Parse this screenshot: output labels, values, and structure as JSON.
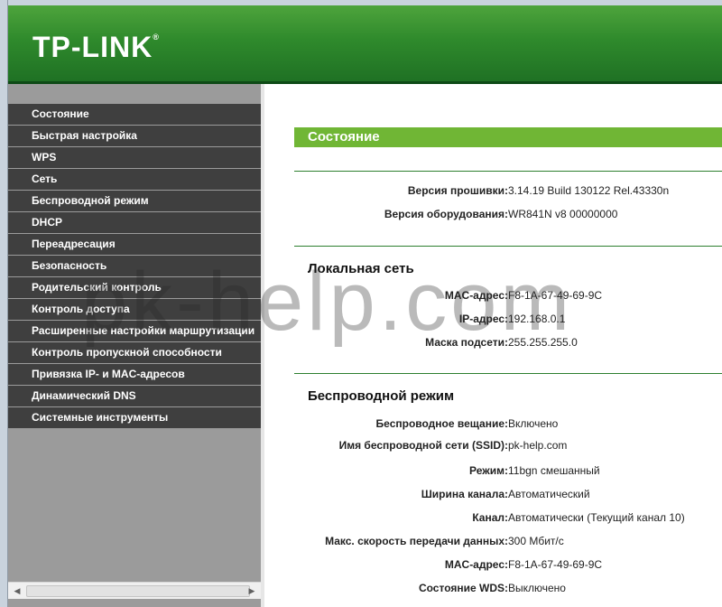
{
  "brand": {
    "logo_text": "TP-LINK",
    "logo_mark": "®"
  },
  "sidebar": {
    "items": [
      {
        "label": "Состояние"
      },
      {
        "label": "Быстрая настройка"
      },
      {
        "label": "WPS"
      },
      {
        "label": "Сеть"
      },
      {
        "label": "Беспроводной режим"
      },
      {
        "label": "DHCP"
      },
      {
        "label": "Переадресация"
      },
      {
        "label": "Безопасность"
      },
      {
        "label": "Родительский контроль"
      },
      {
        "label": "Контроль доступа"
      },
      {
        "label": "Расширенные настройки маршрутизации"
      },
      {
        "label": "Контроль пропускной способности"
      },
      {
        "label": "Привязка IP- и MAC-адресов"
      },
      {
        "label": "Динамический DNS"
      },
      {
        "label": "Системные инструменты"
      }
    ]
  },
  "main": {
    "title": "Состояние",
    "firmware": {
      "version_label": "Версия прошивки:",
      "version_value": "3.14.19 Build 130122 Rel.43330n",
      "hw_label": "Версия оборудования:",
      "hw_value": "WR841N v8 00000000"
    },
    "lan": {
      "title": "Локальная сеть",
      "mac_label": "MAC-адрес:",
      "mac_value": "F8-1A-67-49-69-9C",
      "ip_label": "IP-адрес:",
      "ip_value": "192.168.0.1",
      "mask_label": "Маска подсети:",
      "mask_value": "255.255.255.0"
    },
    "wireless": {
      "title": "Беспроводной режим",
      "broadcast_label": "Беспроводное вещание:",
      "broadcast_value": "Включено",
      "ssid_label": "Имя беспроводной сети (SSID):",
      "ssid_value": "pk-help.com",
      "mode_label": "Режим:",
      "mode_value": "11bgn смешанный",
      "width_label": "Ширина канала:",
      "width_value": "Автоматический",
      "channel_label": "Канал:",
      "channel_value": "Автоматически (Текущий канал 10)",
      "rate_label": "Макс. скорость передачи данных:",
      "rate_value": "300 Мбит/с",
      "mac_label": "MAC-адрес:",
      "mac_value": "F8-1A-67-49-69-9C",
      "wds_label": "Состояние WDS:",
      "wds_value": "Выключено"
    }
  },
  "watermark": "pk-help.com",
  "colors": {
    "header_green": "#2f8a2c",
    "title_green": "#70b635",
    "menu_bg": "#3f3f3f",
    "sidebar_bg": "#9b9b9b"
  }
}
